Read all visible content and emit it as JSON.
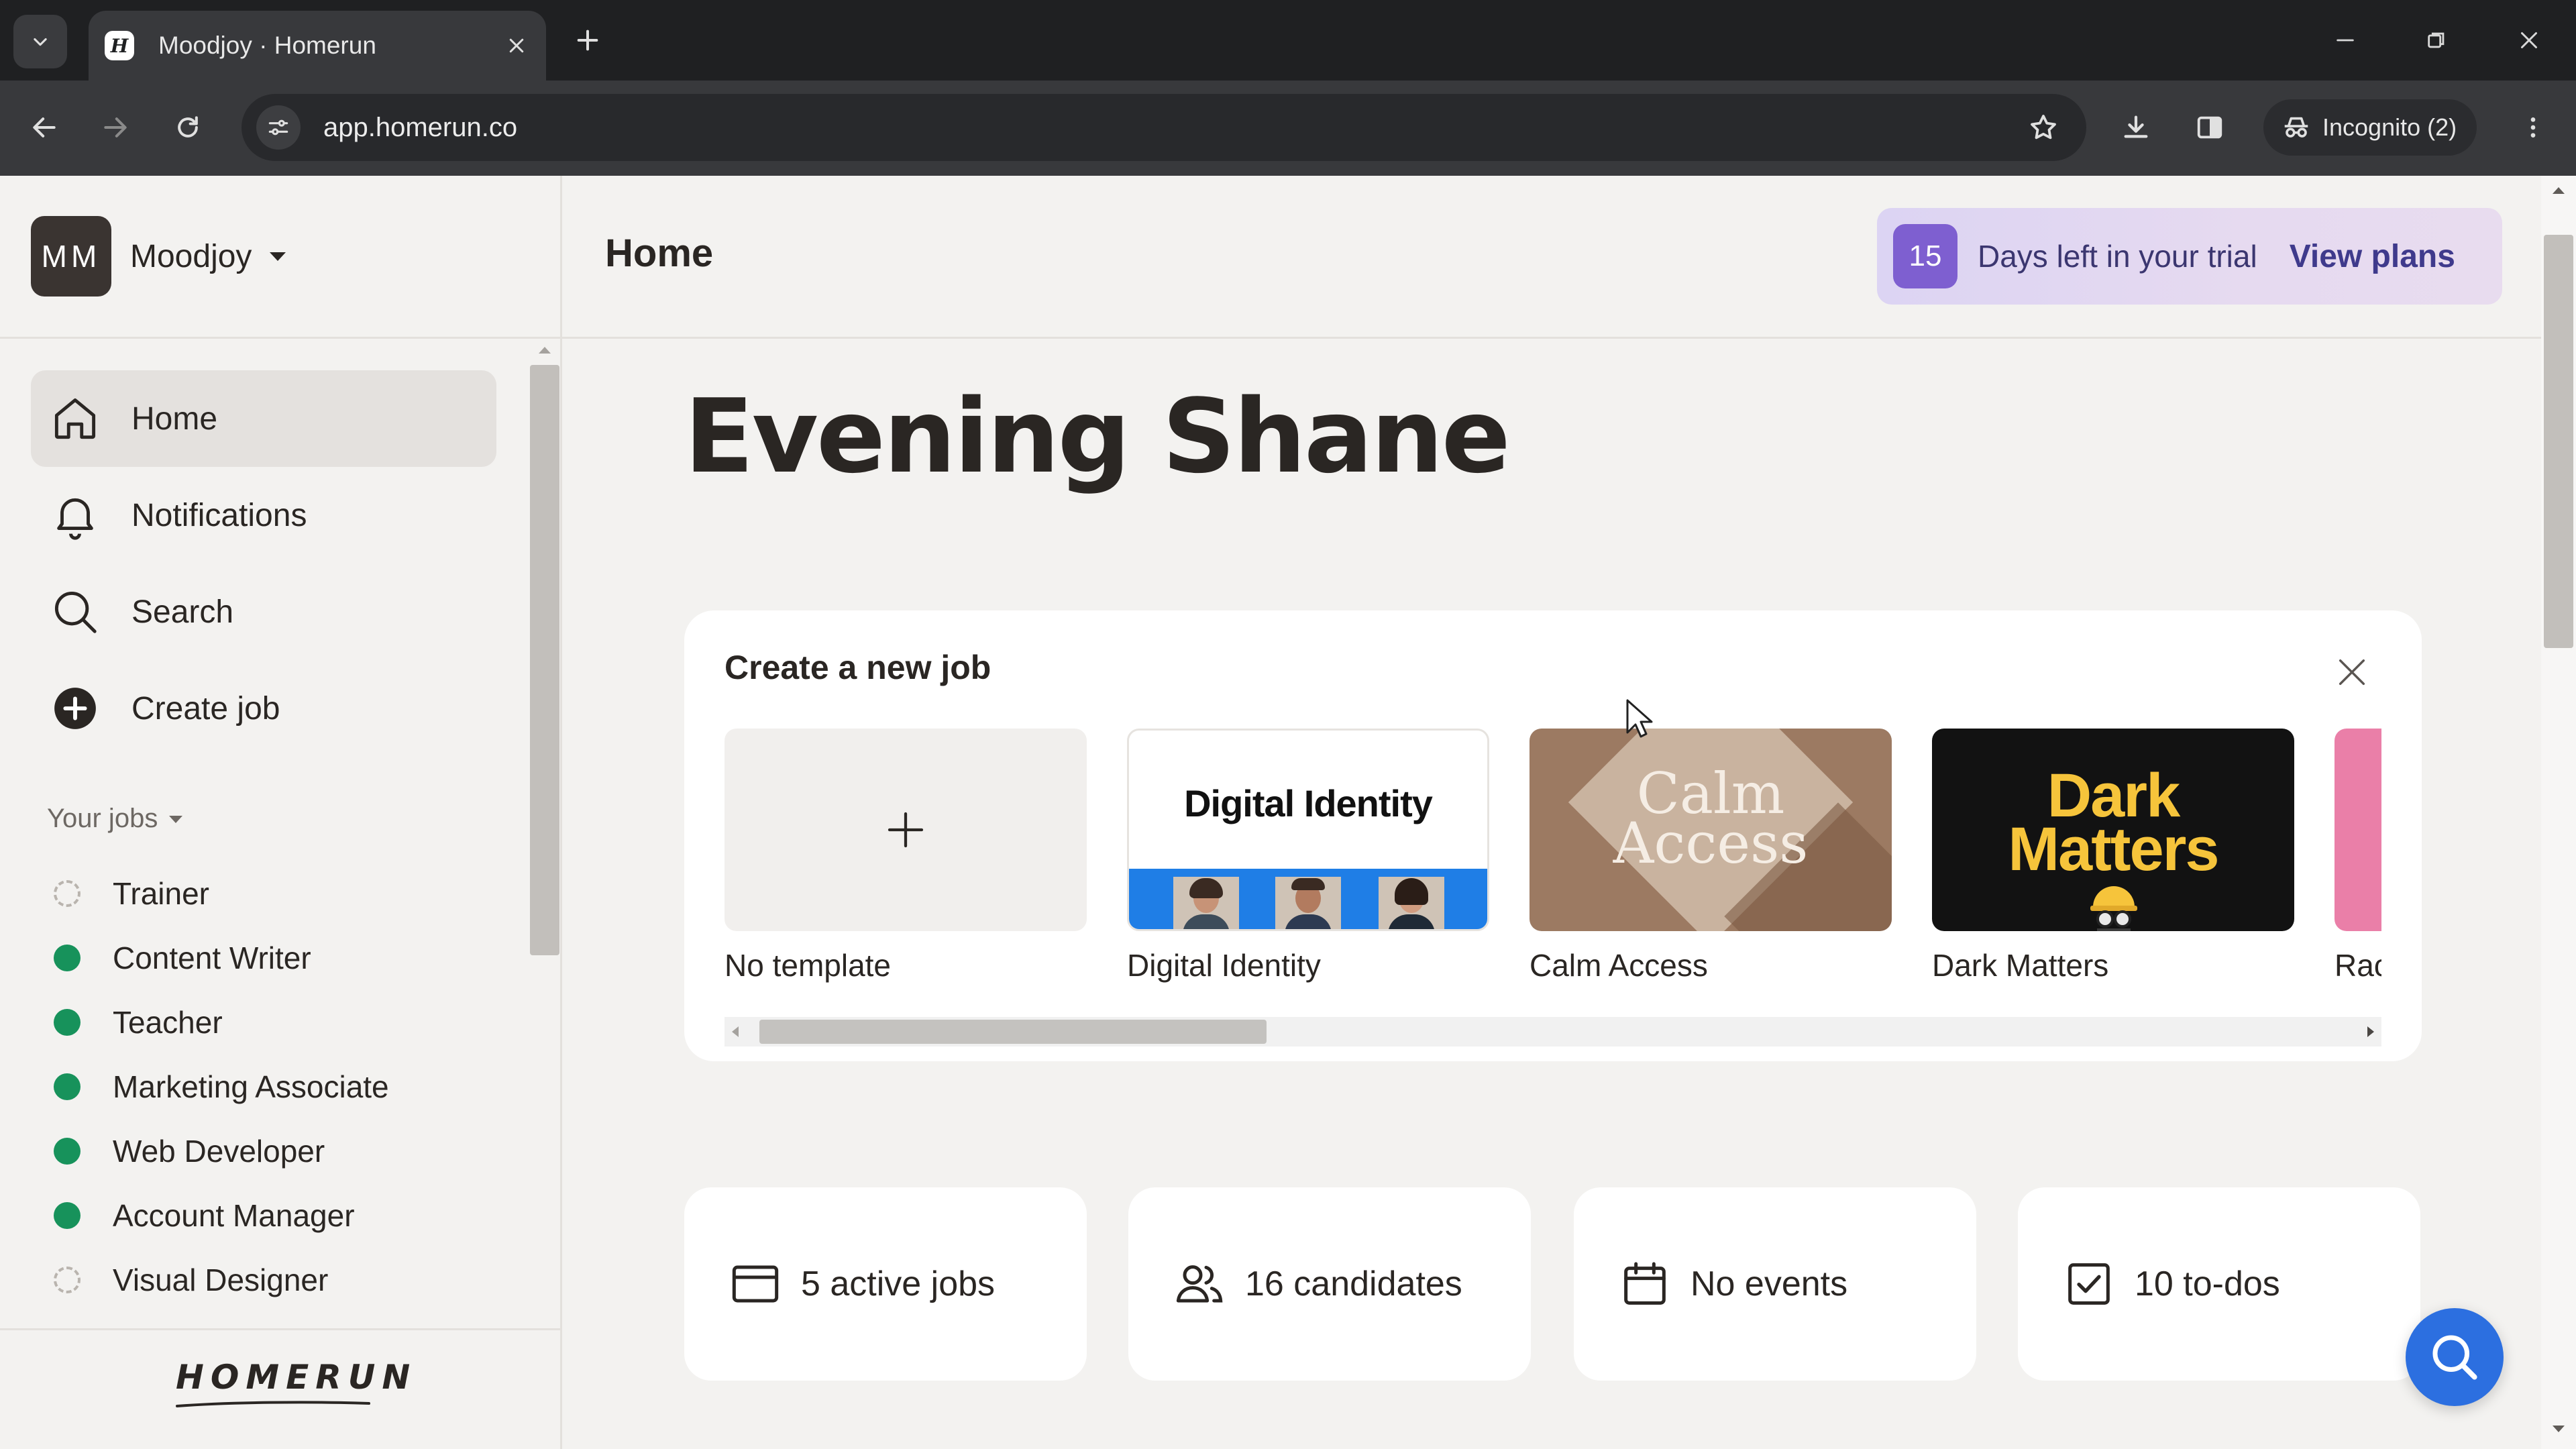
{
  "browser": {
    "tab_title": "Moodjoy · Homerun",
    "url": "app.homerun.co",
    "incognito_label": "Incognito (2)"
  },
  "workspace": {
    "initials": "MM",
    "name": "Moodjoy"
  },
  "sidebar": {
    "nav": [
      {
        "label": "Home",
        "icon": "home-icon",
        "active": true
      },
      {
        "label": "Notifications",
        "icon": "bell-icon",
        "active": false
      },
      {
        "label": "Search",
        "icon": "search-icon",
        "active": false
      },
      {
        "label": "Create job",
        "icon": "plus-circle-icon",
        "active": false
      }
    ],
    "jobs_header": "Your jobs",
    "jobs": [
      {
        "label": "Trainer",
        "status": "draft"
      },
      {
        "label": "Content Writer",
        "status": "live"
      },
      {
        "label": "Teacher",
        "status": "live"
      },
      {
        "label": "Marketing Associate",
        "status": "live"
      },
      {
        "label": "Web Developer",
        "status": "live"
      },
      {
        "label": "Account Manager",
        "status": "live"
      },
      {
        "label": "Visual Designer",
        "status": "draft"
      }
    ],
    "brand": "HOMERUN"
  },
  "header": {
    "title": "Home",
    "trial": {
      "days": "15",
      "text": "Days left in your trial",
      "link": "View plans"
    }
  },
  "greeting": "Evening Shane",
  "create_job": {
    "title": "Create a new job",
    "templates": [
      {
        "label": "No template",
        "thumb": "plus"
      },
      {
        "label": "Digital Identity",
        "thumb_title": "Digital Identity"
      },
      {
        "label": "Calm Access",
        "thumb_title_1": "Calm",
        "thumb_title_2": "Access"
      },
      {
        "label": "Dark Matters",
        "thumb_title_1": "Dark",
        "thumb_title_2": "Matters"
      },
      {
        "label": "Rac"
      }
    ]
  },
  "stats": [
    {
      "label": "5 active jobs",
      "icon": "browser-window-icon"
    },
    {
      "label": "16 candidates",
      "icon": "users-icon"
    },
    {
      "label": "No events",
      "icon": "calendar-icon"
    },
    {
      "label": "10 to-dos",
      "icon": "checkbox-icon"
    }
  ],
  "colors": {
    "accent_purple": "#7e5fd0",
    "live_green": "#17925b",
    "help_blue": "#2c6fe0",
    "digital_identity_blue": "#1f7ee6",
    "dark_matters_yellow": "#f6c43b"
  }
}
